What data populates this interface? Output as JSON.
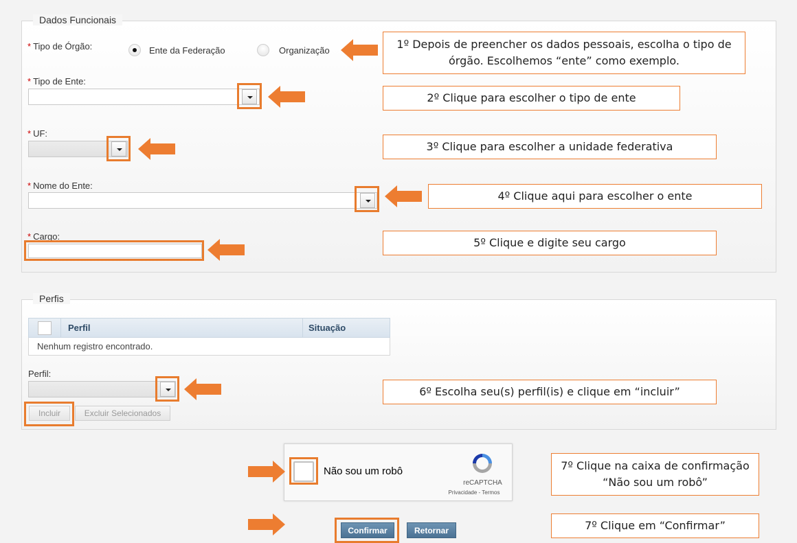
{
  "dados_funcionais": {
    "legend": "Dados Funcionais",
    "tipo_orgao_label": "Tipo de Órgão:",
    "radio_ente": "Ente da Federação",
    "radio_organizacao": "Organização",
    "radio_selected": "ente",
    "tipo_ente_label": "Tipo de Ente:",
    "uf_label": "UF:",
    "nome_ente_label": "Nome do Ente:",
    "cargo_label": "Cargo:",
    "required_marker": "*"
  },
  "perfis": {
    "legend": "Perfis",
    "columns": [
      "Perfil",
      "Situação"
    ],
    "empty_message": "Nenhum registro encontrado.",
    "perfil_label": "Perfil:",
    "incluir_button": "Incluir",
    "excluir_button": "Excluir Selecionados"
  },
  "captcha": {
    "label": "Não sou um robô",
    "brand": "reCAPTCHA",
    "links": "Privacidade - Termos",
    "logo_icon": "recaptcha-logo-icon"
  },
  "actions": {
    "confirmar": "Confirmar",
    "retornar": "Retornar"
  },
  "annotations": [
    "1º Depois de preencher os dados pessoais, escolha o tipo de órgão. Escolhemos “ente” como exemplo.",
    "2º Clique para escolher o tipo de ente",
    "3º Clique para escolher a unidade federativa",
    "4º Clique aqui para escolher o ente",
    "5º Clique e digite seu cargo",
    "6º Escolha seu(s) perfil(is) e clique em “incluir”",
    "7º Clique na caixa de confirmação “Não sou um robô”",
    "7º Clique em “Confirmar”"
  ],
  "colors": {
    "highlight": "#e87c2e",
    "arrow": "#ed7d31",
    "primary_button": "#5a81a3",
    "required": "#cc0000"
  }
}
